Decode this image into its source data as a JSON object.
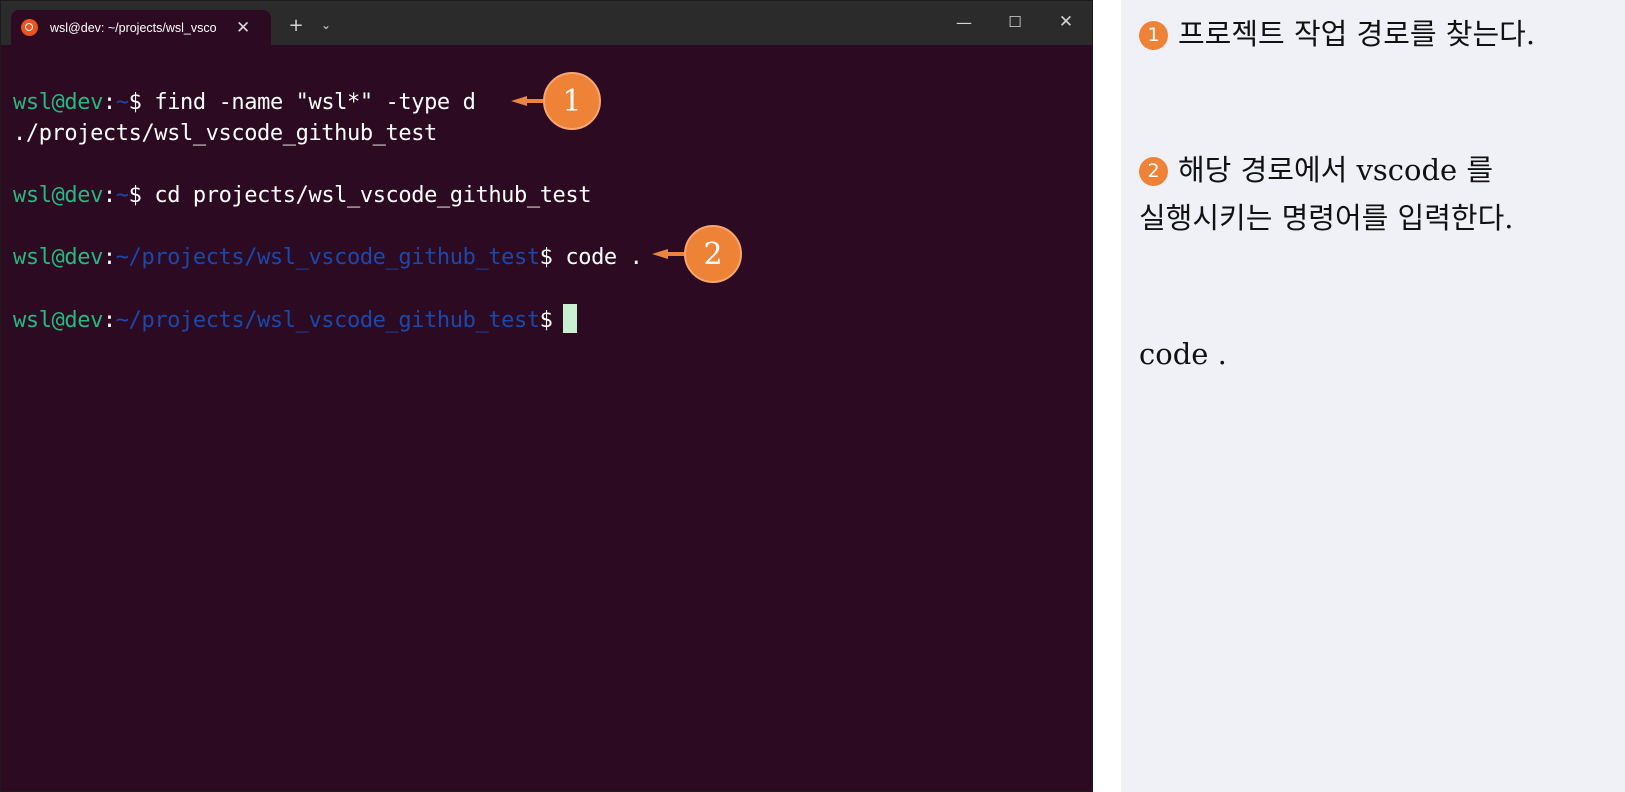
{
  "window": {
    "tab_title": "wsl@dev: ~/projects/wsl_vsco",
    "tab_close": "✕",
    "new_tab": "+",
    "dropdown": "⌄",
    "minimize": "—",
    "maximize": "☐",
    "close": "✕"
  },
  "terminal": {
    "lines": [
      {
        "user": "wsl@dev",
        "sep": ":",
        "path": "~",
        "prompt": "$ ",
        "cmd": "find -name \"wsl*\" -type d"
      },
      {
        "output": "./projects/wsl_vscode_github_test"
      },
      {
        "user": "wsl@dev",
        "sep": ":",
        "path": "~",
        "prompt": "$ ",
        "cmd": "cd projects/wsl_vscode_github_test"
      },
      {
        "user": "wsl@dev",
        "sep": ":",
        "path": "~/projects/wsl_vscode_github_test",
        "prompt": "$ ",
        "cmd": "code ."
      },
      {
        "user": "wsl@dev",
        "sep": ":",
        "path": "~/projects/wsl_vscode_github_test",
        "prompt": "$"
      }
    ],
    "callouts": [
      "1",
      "2"
    ]
  },
  "notes": {
    "n1_num": "1",
    "n1_text": "프로젝트 작업 경로를 찾는다.",
    "n2_num": "2",
    "n2_line1": "해당 경로에서 vscode 를",
    "n2_line2": "실행시키는 명령어를 입력한다.",
    "n3_text": "code ."
  },
  "colors": {
    "terminal_bg": "#2c0a22",
    "user": "#27b77f",
    "path": "#1a48ab",
    "badge": "#ee8236",
    "panel_bg": "#f0f0f7"
  }
}
